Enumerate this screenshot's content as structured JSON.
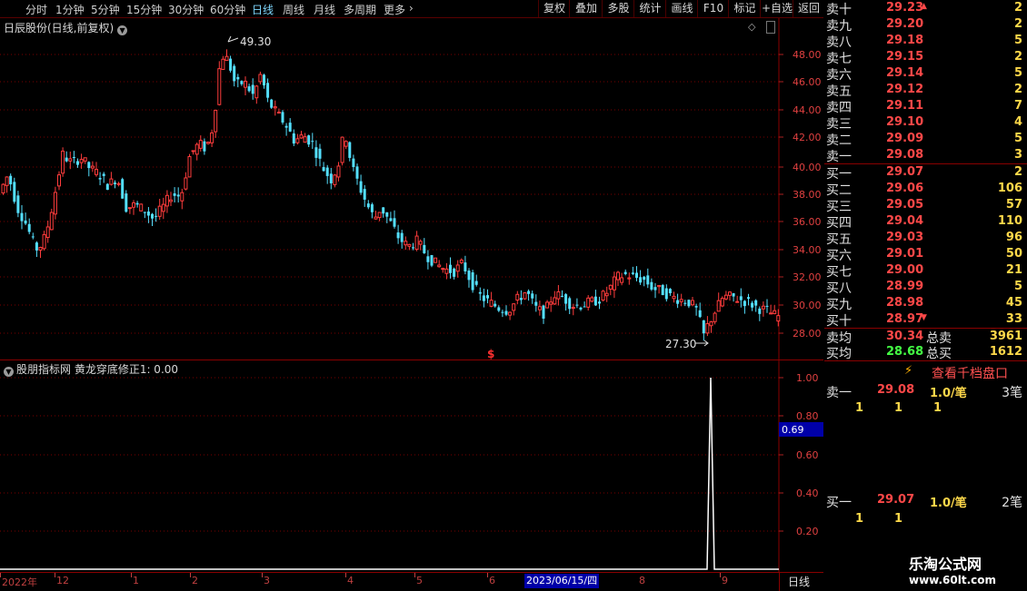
{
  "toolbar": {
    "periods": [
      "分时",
      "1分钟",
      "5分钟",
      "15分钟",
      "30分钟",
      "60分钟",
      "日线",
      "周线",
      "月线",
      "多周期",
      "更多"
    ],
    "active_period": "日线",
    "more_arrow": "›",
    "buttons": [
      "复权",
      "叠加",
      "多股",
      "统计",
      "画线",
      "F10",
      "标记",
      "+自选",
      "返回"
    ]
  },
  "main_chart": {
    "title": "日辰股份(日线,前复权)",
    "high_label": "49.30",
    "low_label": "27.30",
    "signal_marker": "$",
    "y_ticks": [
      "48.00",
      "46.00",
      "44.00",
      "42.00",
      "40.00",
      "38.00",
      "36.00",
      "34.00",
      "32.00",
      "30.00",
      "28.00"
    ]
  },
  "chart_data": {
    "type": "candlestick",
    "ylim": [
      27,
      50
    ],
    "points": [
      [
        0,
        38.0
      ],
      [
        10,
        39.4
      ],
      [
        20,
        37.0
      ],
      [
        30,
        35.8
      ],
      [
        40,
        34.0
      ],
      [
        48,
        34.4
      ],
      [
        55,
        36.0
      ],
      [
        62,
        38.2
      ],
      [
        70,
        40.8
      ],
      [
        80,
        40.2
      ],
      [
        90,
        40.6
      ],
      [
        100,
        39.8
      ],
      [
        110,
        39.4
      ],
      [
        120,
        38.6
      ],
      [
        130,
        39.2
      ],
      [
        140,
        37.0
      ],
      [
        150,
        37.2
      ],
      [
        160,
        36.8
      ],
      [
        170,
        36.2
      ],
      [
        180,
        37.0
      ],
      [
        190,
        38.0
      ],
      [
        200,
        37.8
      ],
      [
        210,
        40.8
      ],
      [
        220,
        41.6
      ],
      [
        228,
        41.2
      ],
      [
        236,
        43.0
      ],
      [
        244,
        48.0
      ],
      [
        252,
        47.6
      ],
      [
        260,
        45.8
      ],
      [
        270,
        46.0
      ],
      [
        280,
        45.0
      ],
      [
        288,
        46.6
      ],
      [
        296,
        44.6
      ],
      [
        305,
        43.8
      ],
      [
        315,
        43.0
      ],
      [
        325,
        41.8
      ],
      [
        335,
        42.2
      ],
      [
        345,
        41.6
      ],
      [
        355,
        40.0
      ],
      [
        365,
        39.0
      ],
      [
        373,
        40.0
      ],
      [
        380,
        42.6
      ],
      [
        388,
        40.0
      ],
      [
        396,
        38.6
      ],
      [
        405,
        37.2
      ],
      [
        413,
        36.2
      ],
      [
        420,
        37.0
      ],
      [
        430,
        36.0
      ],
      [
        440,
        34.8
      ],
      [
        450,
        34.2
      ],
      [
        460,
        34.6
      ],
      [
        470,
        33.6
      ],
      [
        480,
        33.0
      ],
      [
        490,
        32.6
      ],
      [
        500,
        32.4
      ],
      [
        510,
        33.0
      ],
      [
        520,
        31.6
      ],
      [
        530,
        30.6
      ],
      [
        540,
        30.2
      ],
      [
        550,
        29.8
      ],
      [
        560,
        29.6
      ],
      [
        570,
        30.4
      ],
      [
        580,
        31.0
      ],
      [
        590,
        29.8
      ],
      [
        600,
        29.4
      ],
      [
        610,
        30.8
      ],
      [
        620,
        30.6
      ],
      [
        630,
        30.0
      ],
      [
        640,
        30.0
      ],
      [
        650,
        30.2
      ],
      [
        660,
        30.4
      ],
      [
        670,
        31.0
      ],
      [
        680,
        32.0
      ],
      [
        690,
        32.2
      ],
      [
        700,
        32.0
      ],
      [
        710,
        31.8
      ],
      [
        720,
        31.2
      ],
      [
        730,
        31.0
      ],
      [
        740,
        30.6
      ],
      [
        750,
        30.4
      ],
      [
        760,
        30.2
      ],
      [
        768,
        29.6
      ],
      [
        775,
        27.8
      ],
      [
        780,
        28.6
      ],
      [
        788,
        29.6
      ],
      [
        797,
        30.6
      ],
      [
        806,
        30.6
      ],
      [
        815,
        30.4
      ],
      [
        825,
        30.2
      ],
      [
        835,
        29.8
      ],
      [
        845,
        29.6
      ],
      [
        855,
        29.2
      ]
    ]
  },
  "indicator": {
    "title": "股朋指标网 黄龙穿底修正1: 0.00",
    "y_ticks": [
      "1.00",
      "0.80",
      "0.60",
      "0.40",
      "0.20"
    ],
    "cursor_value": "0.69",
    "spike_x": 782
  },
  "x_axis": {
    "labels": [
      "2022年",
      "12",
      "1",
      "2",
      "3",
      "4",
      "5",
      "6",
      "9"
    ],
    "cursor_date": "2023/06/15/四",
    "cursor_label_after": "8",
    "period_label": "日线"
  },
  "order_book": {
    "asks": [
      {
        "label": "卖十",
        "price": "29.23",
        "volume": "2",
        "arrow": "up"
      },
      {
        "label": "卖九",
        "price": "29.20",
        "volume": "2"
      },
      {
        "label": "卖八",
        "price": "29.18",
        "volume": "5"
      },
      {
        "label": "卖七",
        "price": "29.15",
        "volume": "2"
      },
      {
        "label": "卖六",
        "price": "29.14",
        "volume": "5"
      },
      {
        "label": "卖五",
        "price": "29.12",
        "volume": "2"
      },
      {
        "label": "卖四",
        "price": "29.11",
        "volume": "7"
      },
      {
        "label": "卖三",
        "price": "29.10",
        "volume": "4"
      },
      {
        "label": "卖二",
        "price": "29.09",
        "volume": "5"
      },
      {
        "label": "卖一",
        "price": "29.08",
        "volume": "3"
      }
    ],
    "bids": [
      {
        "label": "买一",
        "price": "29.07",
        "volume": "2"
      },
      {
        "label": "买二",
        "price": "29.06",
        "volume": "106"
      },
      {
        "label": "买三",
        "price": "29.05",
        "volume": "57"
      },
      {
        "label": "买四",
        "price": "29.04",
        "volume": "110"
      },
      {
        "label": "买五",
        "price": "29.03",
        "volume": "96"
      },
      {
        "label": "买六",
        "price": "29.01",
        "volume": "50"
      },
      {
        "label": "买七",
        "price": "29.00",
        "volume": "21"
      },
      {
        "label": "买八",
        "price": "28.99",
        "volume": "5"
      },
      {
        "label": "买九",
        "price": "28.98",
        "volume": "45"
      },
      {
        "label": "买十",
        "price": "28.97",
        "volume": "33",
        "arrow": "down"
      }
    ],
    "ask_avg_label": "卖均",
    "ask_avg": "30.34",
    "ask_total_label": "总卖",
    "ask_total": "3961",
    "bid_avg_label": "买均",
    "bid_avg": "28.68",
    "bid_total_label": "总买",
    "bid_total": "1612"
  },
  "detail": {
    "lightning": "⚡",
    "view_button": "查看千档盘口",
    "ask1": {
      "label": "卖一",
      "price": "29.08",
      "per": "1.0/笔",
      "count": "3笔",
      "items": [
        "1",
        "1",
        "1"
      ]
    },
    "bid1": {
      "label": "买一",
      "price": "29.07",
      "per": "1.0/笔",
      "count": "2笔",
      "items": [
        "1",
        "1"
      ]
    }
  },
  "watermark": {
    "title": "乐淘公式网",
    "url": "www.60lt.com"
  }
}
